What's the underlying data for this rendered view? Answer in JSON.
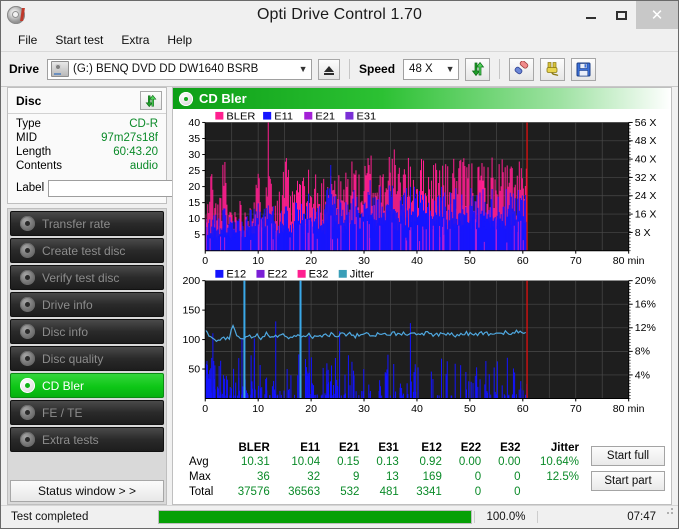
{
  "window": {
    "title": "Opti Drive Control 1.70",
    "app_icon": "disc-icon",
    "minimize": "–",
    "maximize": "□",
    "close": "✕"
  },
  "menu": {
    "items": [
      "File",
      "Start test",
      "Extra",
      "Help"
    ]
  },
  "toolbar": {
    "drive_label": "Drive",
    "drive_value": "(G:)  BENQ DVD DD DW1640 BSRB",
    "eject_icon": "eject-icon",
    "speed_label": "Speed",
    "speed_value": "48 X",
    "refresh_icon": "refresh-icon",
    "eraser_icon": "eraser-icon",
    "plug_icon": "plug-icon",
    "save_icon": "save-icon"
  },
  "disc_panel": {
    "title": "Disc",
    "refresh_icon": "refresh-icon",
    "rows": [
      {
        "key": "Type",
        "value": "CD-R"
      },
      {
        "key": "MID",
        "value": "97m27s18f"
      },
      {
        "key": "Length",
        "value": "60:43.20"
      },
      {
        "key": "Contents",
        "value": "audio"
      }
    ],
    "label_key": "Label",
    "label_value": "",
    "label_placeholder": "",
    "cd_icon": "cd-icon"
  },
  "nav": {
    "items": [
      {
        "label": "Transfer rate",
        "active": false
      },
      {
        "label": "Create test disc",
        "active": false
      },
      {
        "label": "Verify test disc",
        "active": false
      },
      {
        "label": "Drive info",
        "active": false
      },
      {
        "label": "Disc info",
        "active": false
      },
      {
        "label": "Disc quality",
        "active": false
      },
      {
        "label": "CD Bler",
        "active": true
      },
      {
        "label": "FE / TE",
        "active": false
      },
      {
        "label": "Extra tests",
        "active": false
      }
    ],
    "status_window": "Status window > >"
  },
  "main": {
    "header_title": "CD Bler",
    "header_icon": "disc-icon",
    "start_full": "Start full",
    "start_part": "Start part"
  },
  "stats": {
    "columns": [
      "BLER",
      "E11",
      "E21",
      "E31",
      "E12",
      "E22",
      "E32",
      "Jitter"
    ],
    "rows": [
      {
        "label": "Avg",
        "values": [
          "10.31",
          "10.04",
          "0.15",
          "0.13",
          "0.92",
          "0.00",
          "0.00",
          "10.64%"
        ]
      },
      {
        "label": "Max",
        "values": [
          "36",
          "32",
          "9",
          "13",
          "169",
          "0",
          "0",
          "12.5%"
        ]
      },
      {
        "label": "Total",
        "values": [
          "37576",
          "36563",
          "532",
          "481",
          "3341",
          "0",
          "0",
          ""
        ]
      }
    ]
  },
  "statusbar": {
    "text": "Test completed",
    "percent_label": "100.0%",
    "percent_value": 100,
    "elapsed": "07:47"
  },
  "chart_data": [
    {
      "type": "area",
      "id": "bler-chart",
      "title": "CD Bler",
      "xlabel": "min",
      "ylabel": "",
      "xlim": [
        0,
        80
      ],
      "ylim": [
        0,
        40
      ],
      "xticks": [
        0,
        10,
        20,
        30,
        40,
        50,
        60,
        70,
        80
      ],
      "xticklabels": [
        "0",
        "10",
        "20",
        "30",
        "40",
        "50",
        "60",
        "70",
        "80 min"
      ],
      "yticks": [
        5,
        10,
        15,
        20,
        25,
        30,
        35,
        40
      ],
      "y2label": "X",
      "y2lim": [
        0,
        56
      ],
      "y2ticks": [
        8,
        16,
        24,
        32,
        40,
        48,
        56
      ],
      "y2ticklabels": [
        "8 X",
        "16 X",
        "24 X",
        "32 X",
        "40 X",
        "48 X",
        "56 X"
      ],
      "grid": true,
      "legend": [
        {
          "name": "BLER",
          "color": "#ff1f8f"
        },
        {
          "name": "E11",
          "color": "#1414ff"
        },
        {
          "name": "E21",
          "color": "#a31fd6"
        },
        {
          "name": "E31",
          "color": "#7a2fd6"
        }
      ],
      "data_end_min": 60.8,
      "marker_min": 60.8,
      "marker_color": "#e01010",
      "plot_bg": "#1e1e1e",
      "series": [
        {
          "name": "BLER",
          "color": "#ff1f8f",
          "avg": 10.31,
          "max": 36,
          "total": 37576,
          "x": [
            0.3,
            1.0,
            1.6,
            2.2,
            2.9,
            3.5,
            4.2,
            4.8,
            5.4,
            6.1,
            6.7,
            7.4,
            8.0,
            8.6,
            9.3,
            9.9,
            10.6,
            11.2,
            11.8,
            12.5,
            13.1,
            13.8,
            14.4,
            15.0,
            15.7,
            16.3,
            17.0,
            17.6,
            18.2,
            18.9,
            19.5,
            20.2,
            20.8,
            21.4,
            22.1,
            22.7,
            23.4,
            24.0,
            24.6,
            25.3,
            25.9,
            26.6,
            27.2,
            27.8,
            28.5,
            29.1,
            29.8,
            30.4,
            31.0,
            31.7,
            32.3,
            33.0,
            33.6,
            34.2,
            34.9,
            35.5,
            36.2,
            36.8,
            37.4,
            38.1,
            38.7,
            39.4,
            40.0,
            40.6,
            41.3,
            41.9,
            42.6,
            43.2,
            43.8,
            44.5,
            45.1,
            45.8,
            46.4,
            47.0,
            47.7,
            48.3,
            49.0,
            49.6,
            50.2,
            50.9,
            51.5,
            52.2,
            52.8,
            53.4,
            54.1,
            54.7,
            55.4,
            56.0,
            56.6,
            57.3,
            57.9,
            58.6,
            59.2,
            59.8,
            60.4,
            60.8
          ],
          "y": [
            12,
            25,
            15,
            13,
            18,
            27,
            12,
            14,
            11,
            16,
            13,
            12,
            14,
            19,
            16,
            22,
            15,
            21,
            36,
            20,
            17,
            16,
            18,
            26,
            21,
            15,
            19,
            23,
            20,
            18,
            24,
            17,
            22,
            16,
            21,
            19,
            30,
            25,
            22,
            20,
            18,
            24,
            21,
            27,
            23,
            19,
            22,
            25,
            28,
            24,
            21,
            26,
            23,
            33,
            25,
            28,
            22,
            24,
            26,
            23,
            27,
            25,
            22,
            24,
            26,
            23,
            21,
            25,
            23,
            26,
            24,
            22,
            27,
            25,
            23,
            24,
            26,
            23,
            25,
            24,
            22,
            26,
            24,
            23,
            25,
            22,
            24,
            26,
            23,
            25,
            24,
            22,
            25,
            23,
            24,
            20
          ]
        },
        {
          "name": "E11",
          "color": "#1414ff",
          "avg": 10.04,
          "max": 32,
          "total": 36563,
          "x": [
            0.3,
            1.0,
            1.6,
            2.2,
            2.9,
            3.5,
            4.2,
            4.8,
            5.4,
            6.1,
            6.7,
            7.4,
            8.0,
            8.6,
            9.3,
            9.9,
            10.6,
            11.2,
            11.8,
            12.5,
            13.1,
            13.8,
            14.4,
            15.0,
            15.7,
            16.3,
            17.0,
            17.6,
            18.2,
            18.9,
            19.5,
            20.2,
            20.8,
            21.4,
            22.1,
            22.7,
            23.4,
            24.0,
            24.6,
            25.3,
            25.9,
            26.6,
            27.2,
            27.8,
            28.5,
            29.1,
            29.8,
            30.4,
            31.0,
            31.7,
            32.3,
            33.0,
            33.6,
            34.2,
            34.9,
            35.5,
            36.2,
            36.8,
            37.4,
            38.1,
            38.7,
            39.4,
            40.0,
            40.6,
            41.3,
            41.9,
            42.6,
            43.2,
            43.8,
            44.5,
            45.1,
            45.8,
            46.4,
            47.0,
            47.7,
            48.3,
            49.0,
            49.6,
            50.2,
            50.9,
            51.5,
            52.2,
            52.8,
            53.4,
            54.1,
            54.7,
            55.4,
            56.0,
            56.6,
            57.3,
            57.9,
            58.6,
            59.2,
            59.8,
            60.4,
            60.8
          ],
          "y": [
            8,
            10,
            12,
            9,
            11,
            13,
            10,
            9,
            8,
            11,
            10,
            9,
            11,
            14,
            12,
            16,
            11,
            13,
            22,
            14,
            12,
            11,
            13,
            18,
            15,
            11,
            14,
            17,
            15,
            13,
            18,
            12,
            16,
            12,
            15,
            14,
            30,
            18,
            16,
            15,
            13,
            17,
            15,
            19,
            17,
            14,
            16,
            18,
            20,
            17,
            15,
            19,
            17,
            24,
            18,
            20,
            16,
            17,
            19,
            17,
            20,
            18,
            16,
            17,
            19,
            17,
            15,
            18,
            17,
            19,
            17,
            16,
            20,
            18,
            17,
            18,
            19,
            17,
            18,
            17,
            16,
            19,
            17,
            17,
            18,
            16,
            17,
            19,
            17,
            18,
            17,
            16,
            18,
            17,
            18,
            15
          ]
        },
        {
          "name": "E21",
          "color": "#a31fd6",
          "avg": 0.15,
          "max": 9,
          "total": 532
        },
        {
          "name": "E31",
          "color": "#7a2fd6",
          "avg": 0.13,
          "max": 13,
          "total": 481
        }
      ]
    },
    {
      "type": "line",
      "id": "e12-jitter-chart",
      "title": "",
      "xlabel": "min",
      "ylabel": "",
      "xlim": [
        0,
        80
      ],
      "ylim": [
        0,
        200
      ],
      "xticks": [
        0,
        10,
        20,
        30,
        40,
        50,
        60,
        70,
        80
      ],
      "xticklabels": [
        "0",
        "10",
        "20",
        "30",
        "40",
        "50",
        "60",
        "70",
        "80 min"
      ],
      "yticks": [
        50,
        100,
        150,
        200
      ],
      "y2lim": [
        0,
        20
      ],
      "y2ticks": [
        4,
        8,
        12,
        16,
        20
      ],
      "y2ticklabels": [
        "4%",
        "8%",
        "12%",
        "16%",
        "20%"
      ],
      "grid": true,
      "legend": [
        {
          "name": "E12",
          "color": "#1414ff"
        },
        {
          "name": "E22",
          "color": "#7a1fd6"
        },
        {
          "name": "E32",
          "color": "#ff1f8f"
        },
        {
          "name": "Jitter",
          "color": "#3a9fb8"
        }
      ],
      "data_end_min": 60.8,
      "marker_min": 60.8,
      "marker_color": "#e01010",
      "plot_bg": "#1e1e1e",
      "series": [
        {
          "name": "Jitter",
          "color": "#4fa8e0",
          "avg_percent": 10.64,
          "max_percent": 12.5,
          "x": [
            0.2,
            0.8,
            1.4,
            2.1,
            2.7,
            3.4,
            4.0,
            4.6,
            5.3,
            5.9,
            6.6,
            7.2,
            7.8,
            8.5,
            9.1,
            9.8,
            10.4,
            11.0,
            11.7,
            12.3,
            13.0,
            13.6,
            14.2,
            14.9,
            15.5,
            16.2,
            16.8,
            17.4,
            18.1,
            18.7,
            19.4,
            20.0,
            20.6,
            21.3,
            21.9,
            22.6,
            23.2,
            23.8,
            24.5,
            25.1,
            25.8,
            26.4,
            27.0,
            27.7,
            28.3,
            29.0,
            29.6,
            30.2,
            30.9,
            31.5,
            32.2,
            32.8,
            33.4,
            34.1,
            34.7,
            35.4,
            36.0,
            36.6,
            37.3,
            37.9,
            38.6,
            39.2,
            39.8,
            40.5,
            41.1,
            41.8,
            42.4,
            43.0,
            43.7,
            44.3,
            45.0,
            45.6,
            46.2,
            46.9,
            47.5,
            48.2,
            48.8,
            49.4,
            50.1,
            50.7,
            51.4,
            52.0,
            52.6,
            53.3,
            53.9,
            54.6,
            55.2,
            55.8,
            56.5,
            57.1,
            57.8,
            58.4,
            59.0,
            59.7,
            60.3,
            60.8
          ],
          "y": [
            115,
            108,
            102,
            100,
            99,
            101,
            100,
            104,
            127,
            109,
            105,
            104,
            103,
            106,
            104,
            107,
            103,
            106,
            110,
            105,
            103,
            106,
            104,
            108,
            105,
            104,
            110,
            107,
            105,
            104,
            108,
            106,
            104,
            107,
            105,
            108,
            106,
            110,
            108,
            106,
            109,
            107,
            110,
            108,
            106,
            109,
            111,
            108,
            110,
            107,
            109,
            111,
            108,
            110,
            108,
            111,
            109,
            107,
            110,
            108,
            111,
            109,
            107,
            110,
            108,
            111,
            109,
            107,
            110,
            108,
            110,
            108,
            111,
            109,
            107,
            110,
            108,
            111,
            109,
            107,
            110,
            112,
            109,
            111,
            108,
            110,
            112,
            109,
            111,
            113,
            110,
            112,
            114,
            111,
            110,
            110
          ]
        },
        {
          "name": "E12",
          "color": "#1414ff",
          "avg": 0.92,
          "max": 169,
          "total": 3341
        },
        {
          "name": "E22",
          "color": "#7a1fd6",
          "avg": 0.0,
          "max": 0,
          "total": 0
        },
        {
          "name": "E32",
          "color": "#ff1f8f",
          "avg": 0.0,
          "max": 0,
          "total": 0
        }
      ]
    }
  ]
}
